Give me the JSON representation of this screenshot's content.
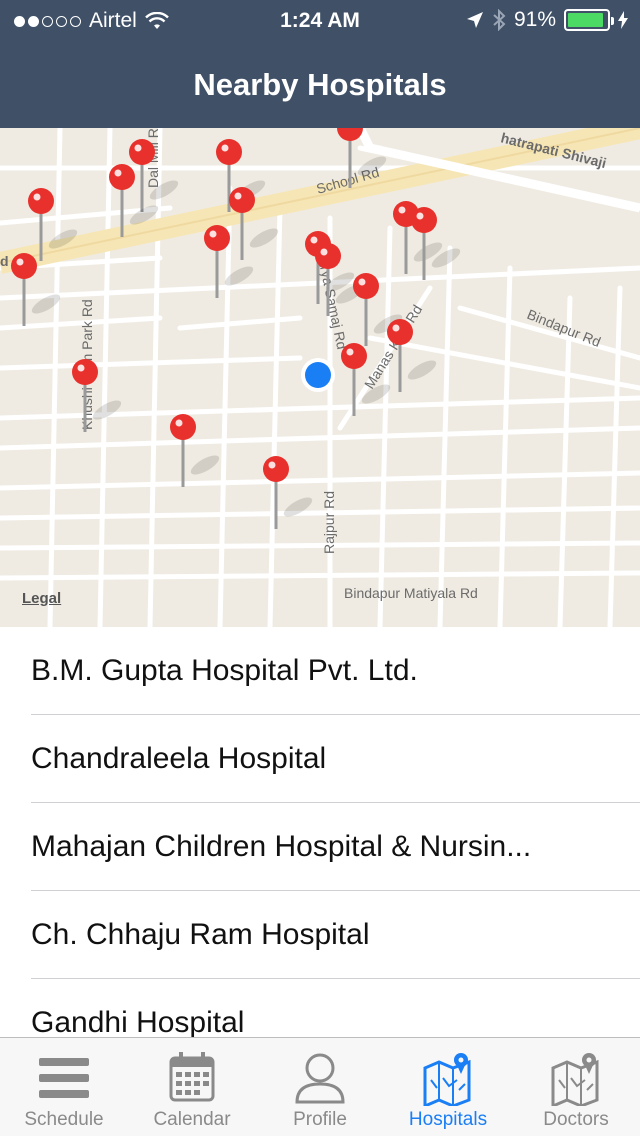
{
  "status_bar": {
    "carrier": "Airtel",
    "time": "1:24 AM",
    "battery_percent": "91%",
    "battery_level": 0.91,
    "signal_bars_on": 2,
    "signal_bars_total": 5
  },
  "nav": {
    "title": "Nearby Hospitals"
  },
  "map": {
    "legal_label": "Legal",
    "road_labels": {
      "school_rd": "School Rd",
      "chhatrapati": "hatrapati Shivaji",
      "dal_mill": "Dal Mill Rd",
      "khushi_ram": "Khushi Ram Park Rd",
      "arya_samaj": "Arya Samaj Rd",
      "manas_kunj": "Manas Kunj Rd",
      "bindapur": "Bindapur Rd",
      "rajpur": "Rajpur Rd",
      "bindapur_matiyala": "Bindapur Matiyala Rd",
      "edge_d": "d"
    },
    "pin_color": "#e8302c",
    "user_location_color": "#1a7ef5"
  },
  "hospitals": [
    {
      "name": "B.M. Gupta Hospital Pvt. Ltd."
    },
    {
      "name": "Chandraleela Hospital"
    },
    {
      "name": "Mahajan Children Hospital & Nursin..."
    },
    {
      "name": "Ch. Chhaju Ram Hospital"
    },
    {
      "name": "Gandhi Hospital"
    }
  ],
  "tabs": [
    {
      "label": "Schedule",
      "icon": "list-icon",
      "active": false
    },
    {
      "label": "Calendar",
      "icon": "calendar-icon",
      "active": false
    },
    {
      "label": "Profile",
      "icon": "profile-icon",
      "active": false
    },
    {
      "label": "Hospitals",
      "icon": "map-pin-icon",
      "active": true
    },
    {
      "label": "Doctors",
      "icon": "map-pin-icon",
      "active": false
    }
  ],
  "colors": {
    "nav_bg": "#3f5067",
    "active_tab": "#1a7ef5",
    "inactive_tab": "#8a8a8a"
  }
}
